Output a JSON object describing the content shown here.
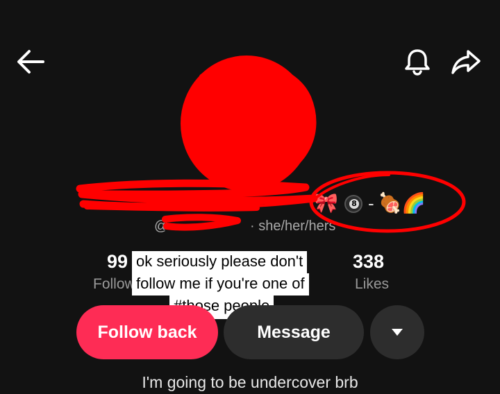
{
  "colors": {
    "background": "#121212",
    "follow_button": "#fe2c55",
    "secondary_button": "#2d2d2d",
    "scribble": "#ff0000"
  },
  "header": {
    "back_icon": "arrow-left-icon",
    "bell_icon": "bell-icon",
    "share_icon": "share-arrow-icon"
  },
  "profile": {
    "emojis": [
      "🎀",
      "8",
      "-",
      "🍖",
      "🌈"
    ],
    "handle_visible": "@",
    "pronouns": "· she/her/hers"
  },
  "stats": {
    "following_count": "99",
    "following_label": "Follow",
    "likes_count": "338",
    "likes_label": "Likes"
  },
  "caption_overlay": {
    "line1": "ok seriously please don't",
    "line2": "follow me if you're one of",
    "line3": "#those people"
  },
  "actions": {
    "follow_back": "Follow back",
    "message": "Message",
    "more_icon": "caret-down-icon"
  },
  "bio": "I'm going to be undercover brb"
}
